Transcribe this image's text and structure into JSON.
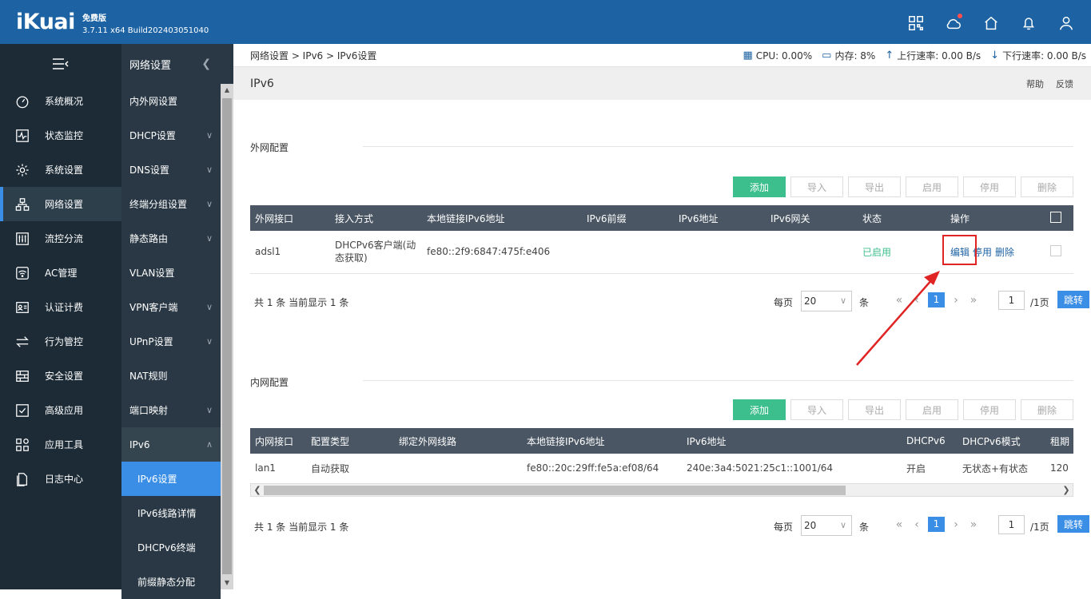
{
  "topbar": {
    "logo": "iKuai",
    "edition": "免费版",
    "version": "3.7.11 x64 Build202403051040",
    "icons": [
      "qr-icon",
      "cloud-icon",
      "home-icon",
      "bell-icon",
      "user-icon"
    ]
  },
  "sidebar": {
    "items": [
      {
        "label": "系统概况",
        "icon": "dashboard-icon"
      },
      {
        "label": "状态监控",
        "icon": "monitor-icon"
      },
      {
        "label": "系统设置",
        "icon": "gear-icon"
      },
      {
        "label": "网络设置",
        "icon": "network-icon"
      },
      {
        "label": "流控分流",
        "icon": "slider-icon"
      },
      {
        "label": "AC管理",
        "icon": "wifi-icon"
      },
      {
        "label": "认证计费",
        "icon": "id-card-icon"
      },
      {
        "label": "行为管控",
        "icon": "swap-icon"
      },
      {
        "label": "安全设置",
        "icon": "firewall-icon"
      },
      {
        "label": "高级应用",
        "icon": "check-box-icon"
      },
      {
        "label": "应用工具",
        "icon": "tools-icon"
      },
      {
        "label": "日志中心",
        "icon": "document-icon"
      }
    ]
  },
  "subnav": {
    "title": "网络设置",
    "items": [
      {
        "label": "内外网设置",
        "chevron": false
      },
      {
        "label": "DHCP设置",
        "chevron": true
      },
      {
        "label": "DNS设置",
        "chevron": true
      },
      {
        "label": "终端分组设置",
        "chevron": true
      },
      {
        "label": "静态路由",
        "chevron": true
      },
      {
        "label": "VLAN设置",
        "chevron": false
      },
      {
        "label": "VPN客户端",
        "chevron": true
      },
      {
        "label": "UPnP设置",
        "chevron": true
      },
      {
        "label": "NAT规则",
        "chevron": false
      },
      {
        "label": "端口映射",
        "chevron": true
      },
      {
        "label": "IPv6",
        "chevron": true
      }
    ],
    "children": [
      "IPv6设置",
      "IPv6线路详情",
      "DHCPv6终端",
      "前缀静态分配"
    ]
  },
  "breadcrumb": "网络设置 > IPv6 > IPv6设置",
  "stats": {
    "cpu": "CPU: 0.00%",
    "mem": "内存: 8%",
    "up": "上行速率: 0.00 B/s",
    "down": "下行速率: 0.00 B/s"
  },
  "page_title": "IPv6",
  "title_links": {
    "help": "帮助",
    "feedback": "反馈"
  },
  "buttons": {
    "add": "添加",
    "import": "导入",
    "export": "导出",
    "enable": "启用",
    "disable": "停用",
    "delete": "删除"
  },
  "wan": {
    "title": "外网配置",
    "headers": [
      "外网接口",
      "接入方式",
      "本地链接IPv6地址",
      "IPv6前缀",
      "IPv6地址",
      "IPv6网关",
      "状态",
      "操作"
    ],
    "row": {
      "iface": "adsl1",
      "mode": "DHCPv6客户端(动态获取)",
      "local": "fe80::2f9:6847:475f:e406",
      "prefix": "",
      "addr": "",
      "gateway": "",
      "status": "已启用",
      "edit": "编辑",
      "disable": "停用",
      "delete": "删除"
    }
  },
  "lan": {
    "title": "内网配置",
    "headers": [
      "内网接口",
      "配置类型",
      "绑定外网线路",
      "本地链接IPv6地址",
      "IPv6地址",
      "DHCPv6",
      "DHCPv6模式",
      "租期"
    ],
    "row": {
      "iface": "lan1",
      "type": "自动获取",
      "bind": "",
      "local": "fe80::20c:29ff:fe5a:ef08/64",
      "addr": "240e:3a4:5021:25c1::1001/64",
      "dhcp": "开启",
      "mode": "无状态+有状态",
      "lease": "120"
    }
  },
  "pager": {
    "total": "共 1 条 当前显示 1 条",
    "perpage": "每页",
    "size": "20",
    "unit": "条",
    "current": "1",
    "page_input": "1",
    "page_total": "/1页",
    "jump": "跳转"
  }
}
